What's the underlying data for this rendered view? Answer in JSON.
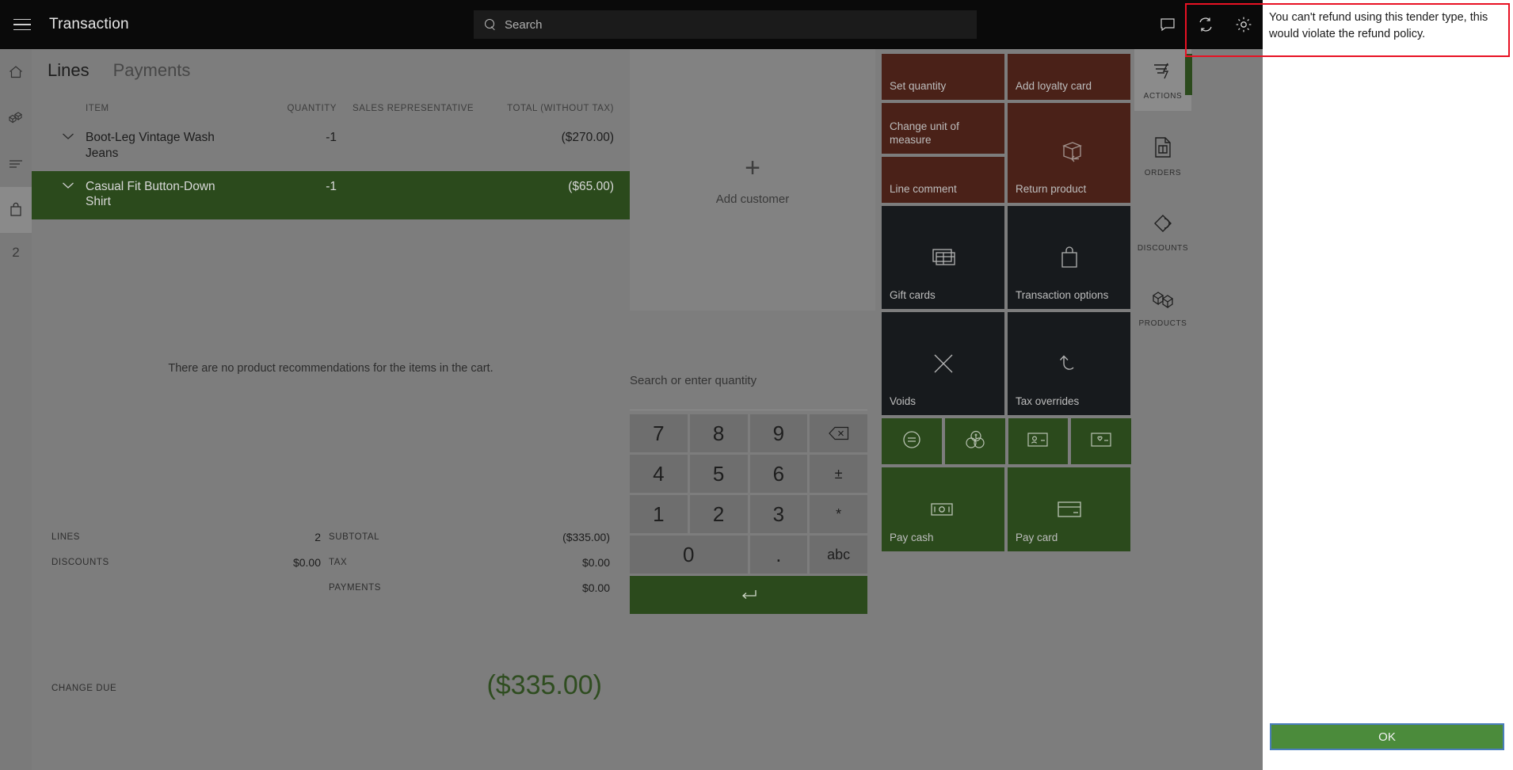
{
  "topbar": {
    "menu_icon": "hamburger-icon",
    "title": "Transaction",
    "search_placeholder": "Search",
    "icons": [
      "feedback-icon",
      "sync-icon",
      "settings-icon"
    ]
  },
  "left_rail": {
    "items": [
      {
        "icon": "home-icon",
        "name": "home"
      },
      {
        "icon": "products-icon",
        "name": "products"
      },
      {
        "icon": "list-icon",
        "name": "lines"
      },
      {
        "icon": "bag-icon",
        "name": "cart",
        "selected": true
      }
    ],
    "count": "2"
  },
  "cart": {
    "tabs": [
      {
        "label": "Lines",
        "active": true
      },
      {
        "label": "Payments",
        "active": false
      }
    ],
    "columns": {
      "item": "ITEM",
      "quantity": "QUANTITY",
      "sales_representative": "SALES REPRESENTATIVE",
      "total": "TOTAL (WITHOUT TAX)"
    },
    "rows": [
      {
        "name": "Boot-Leg Vintage Wash Jeans",
        "quantity": "-1",
        "sales_representative": "",
        "total": "($270.00)",
        "selected": false
      },
      {
        "name": "Casual Fit Button-Down Shirt",
        "quantity": "-1",
        "sales_representative": "",
        "total": "($65.00)",
        "selected": true
      }
    ],
    "recommendation_message": "There are no product recommendations for the items in the cart."
  },
  "totals": {
    "left": [
      {
        "label": "LINES",
        "value": "2"
      },
      {
        "label": "DISCOUNTS",
        "value": "$0.00"
      }
    ],
    "right": [
      {
        "label": "SUBTOTAL",
        "value": "($335.00)"
      },
      {
        "label": "TAX",
        "value": "$0.00"
      },
      {
        "label": "PAYMENTS",
        "value": "$0.00"
      }
    ],
    "change_due_label": "CHANGE DUE",
    "change_due_value": "($335.00)"
  },
  "customer": {
    "plus": "+",
    "label": "Add customer"
  },
  "numpad": {
    "hint": "Search or enter quantity",
    "keys": [
      "7",
      "8",
      "9",
      "backspace-icon",
      "4",
      "5",
      "6",
      "±",
      "1",
      "2",
      "3",
      "*",
      "0",
      ".",
      "abc"
    ],
    "enter_icon": "enter-arrow-icon"
  },
  "tiles": [
    {
      "label": "Set quantity",
      "color": "red",
      "icon": ""
    },
    {
      "label": "Add loyalty card",
      "color": "red",
      "icon": ""
    },
    {
      "label": "Change unit of measure",
      "color": "red",
      "icon": ""
    },
    {
      "label": "Return product",
      "color": "red",
      "icon": "return-product-icon"
    },
    {
      "label": "Line comment",
      "color": "red",
      "icon": ""
    },
    {
      "label": "Gift cards",
      "color": "dark",
      "icon": "gift-card-icon"
    },
    {
      "label": "Transaction options",
      "color": "dark",
      "icon": "shopping-bag-icon"
    },
    {
      "label": "Voids",
      "color": "dark",
      "icon": "close-x-icon"
    },
    {
      "label": "Tax overrides",
      "color": "dark",
      "icon": "undo-arrow-icon"
    },
    {
      "label": "Pay cash",
      "color": "green",
      "icon": "cash-icon"
    },
    {
      "label": "Pay card",
      "color": "green",
      "icon": "credit-card-icon"
    }
  ],
  "quick_tiles": [
    {
      "icon": "equals-circle-icon",
      "name": "exact-amount"
    },
    {
      "icon": "currency-coins-icon",
      "name": "foreign-currency"
    },
    {
      "icon": "id-card-icon",
      "name": "customer-account"
    },
    {
      "icon": "loyalty-heart-card-icon",
      "name": "loyalty-card"
    }
  ],
  "right_nav": [
    {
      "label": "ACTIONS",
      "icon": "actions-lightning-icon",
      "selected": true
    },
    {
      "label": "ORDERS",
      "icon": "orders-document-icon",
      "selected": false
    },
    {
      "label": "DISCOUNTS",
      "icon": "discount-tag-icon",
      "selected": false
    },
    {
      "label": "PRODUCTS",
      "icon": "products-boxes-icon",
      "selected": false
    }
  ],
  "modal": {
    "message": "You can't refund using this tender type, this would violate the refund policy.",
    "ok_label": "OK"
  },
  "colors": {
    "accent_green": "#2b4a1c",
    "tile_red": "#4a2118",
    "tile_dark": "#171a1d",
    "ok_button_green": "#4b8b3b",
    "highlight_red": "#e81123",
    "dim_overlay": "#7d7d7d"
  }
}
